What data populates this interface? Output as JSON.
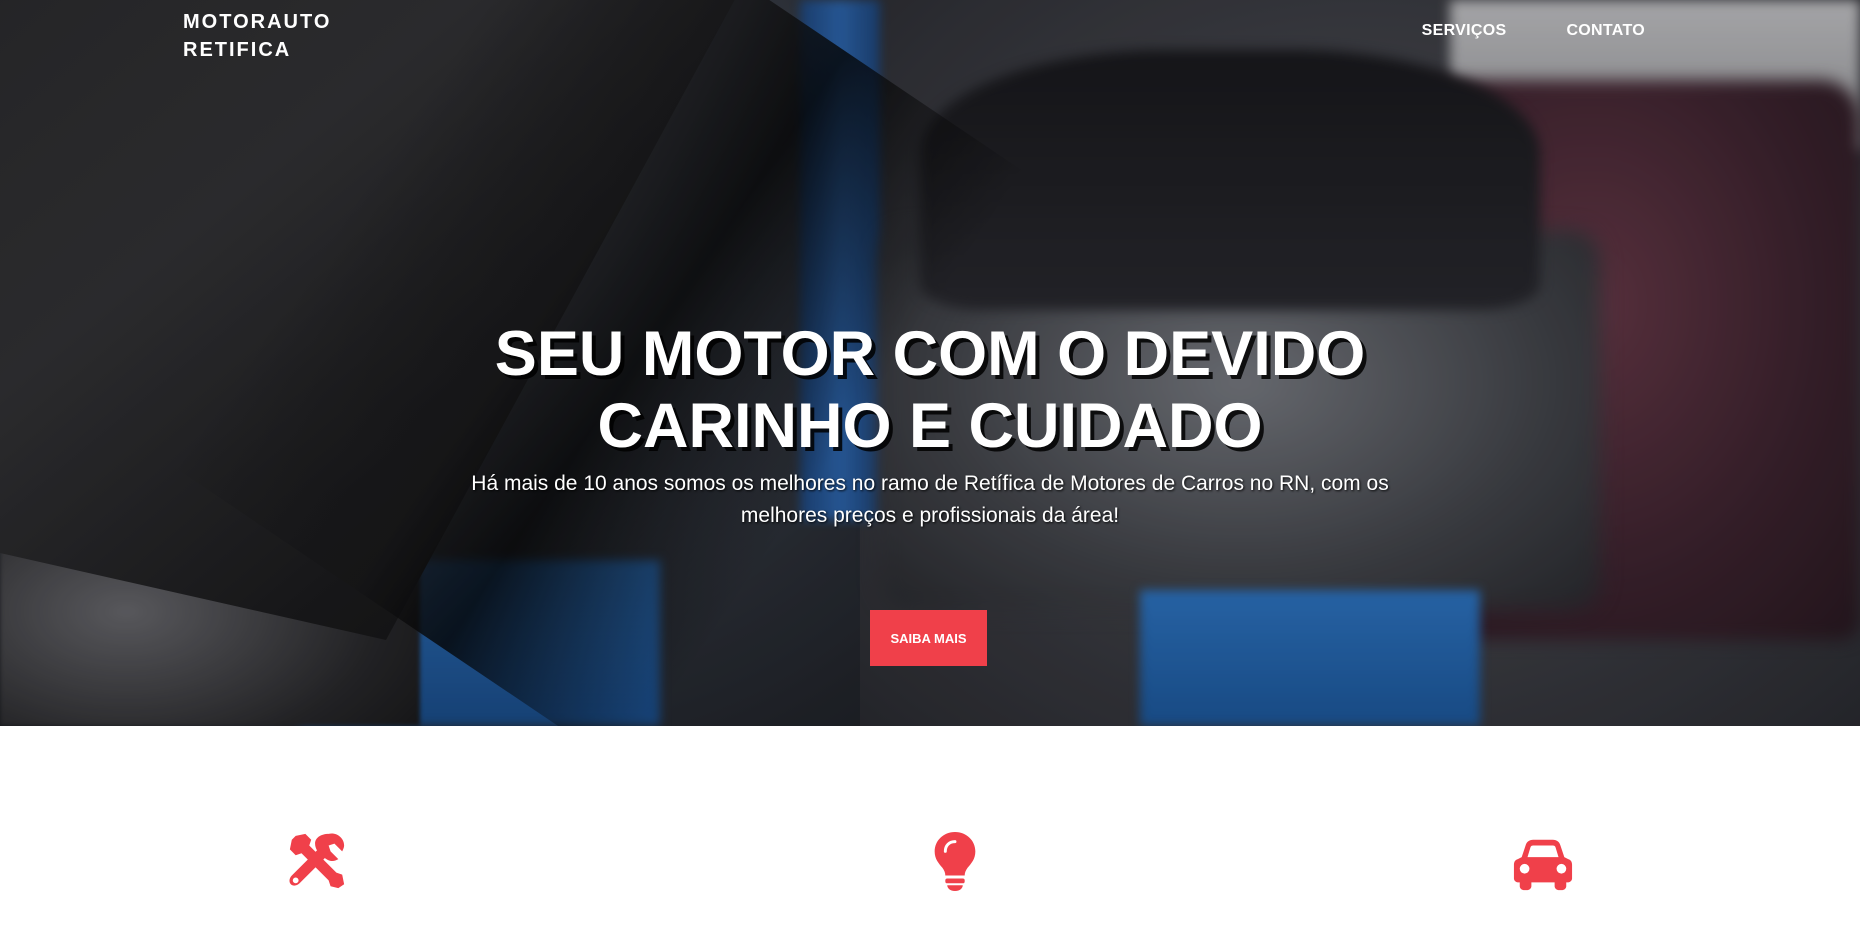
{
  "brand": {
    "line1": "MOTORAUTO",
    "line2": "RETIFICA"
  },
  "nav": {
    "items": [
      {
        "label": "SERVIÇOS"
      },
      {
        "label": "CONTATO"
      }
    ]
  },
  "hero": {
    "title_line1": "SEU MOTOR COM O DEVIDO",
    "title_line2": "CARINHO E CUIDADO",
    "subtitle": "Há mais de 10 anos somos os melhores no ramo de Retífica de Motores de Carros no RN, com os melhores preços e profissionais da área!",
    "cta_label": "SAIBA MAIS"
  },
  "features": {
    "icons": [
      "tools-icon",
      "lightbulb-icon",
      "car-icon"
    ]
  },
  "colors": {
    "accent": "#f0404a",
    "text_light": "#ffffff",
    "background": "#ffffff"
  }
}
